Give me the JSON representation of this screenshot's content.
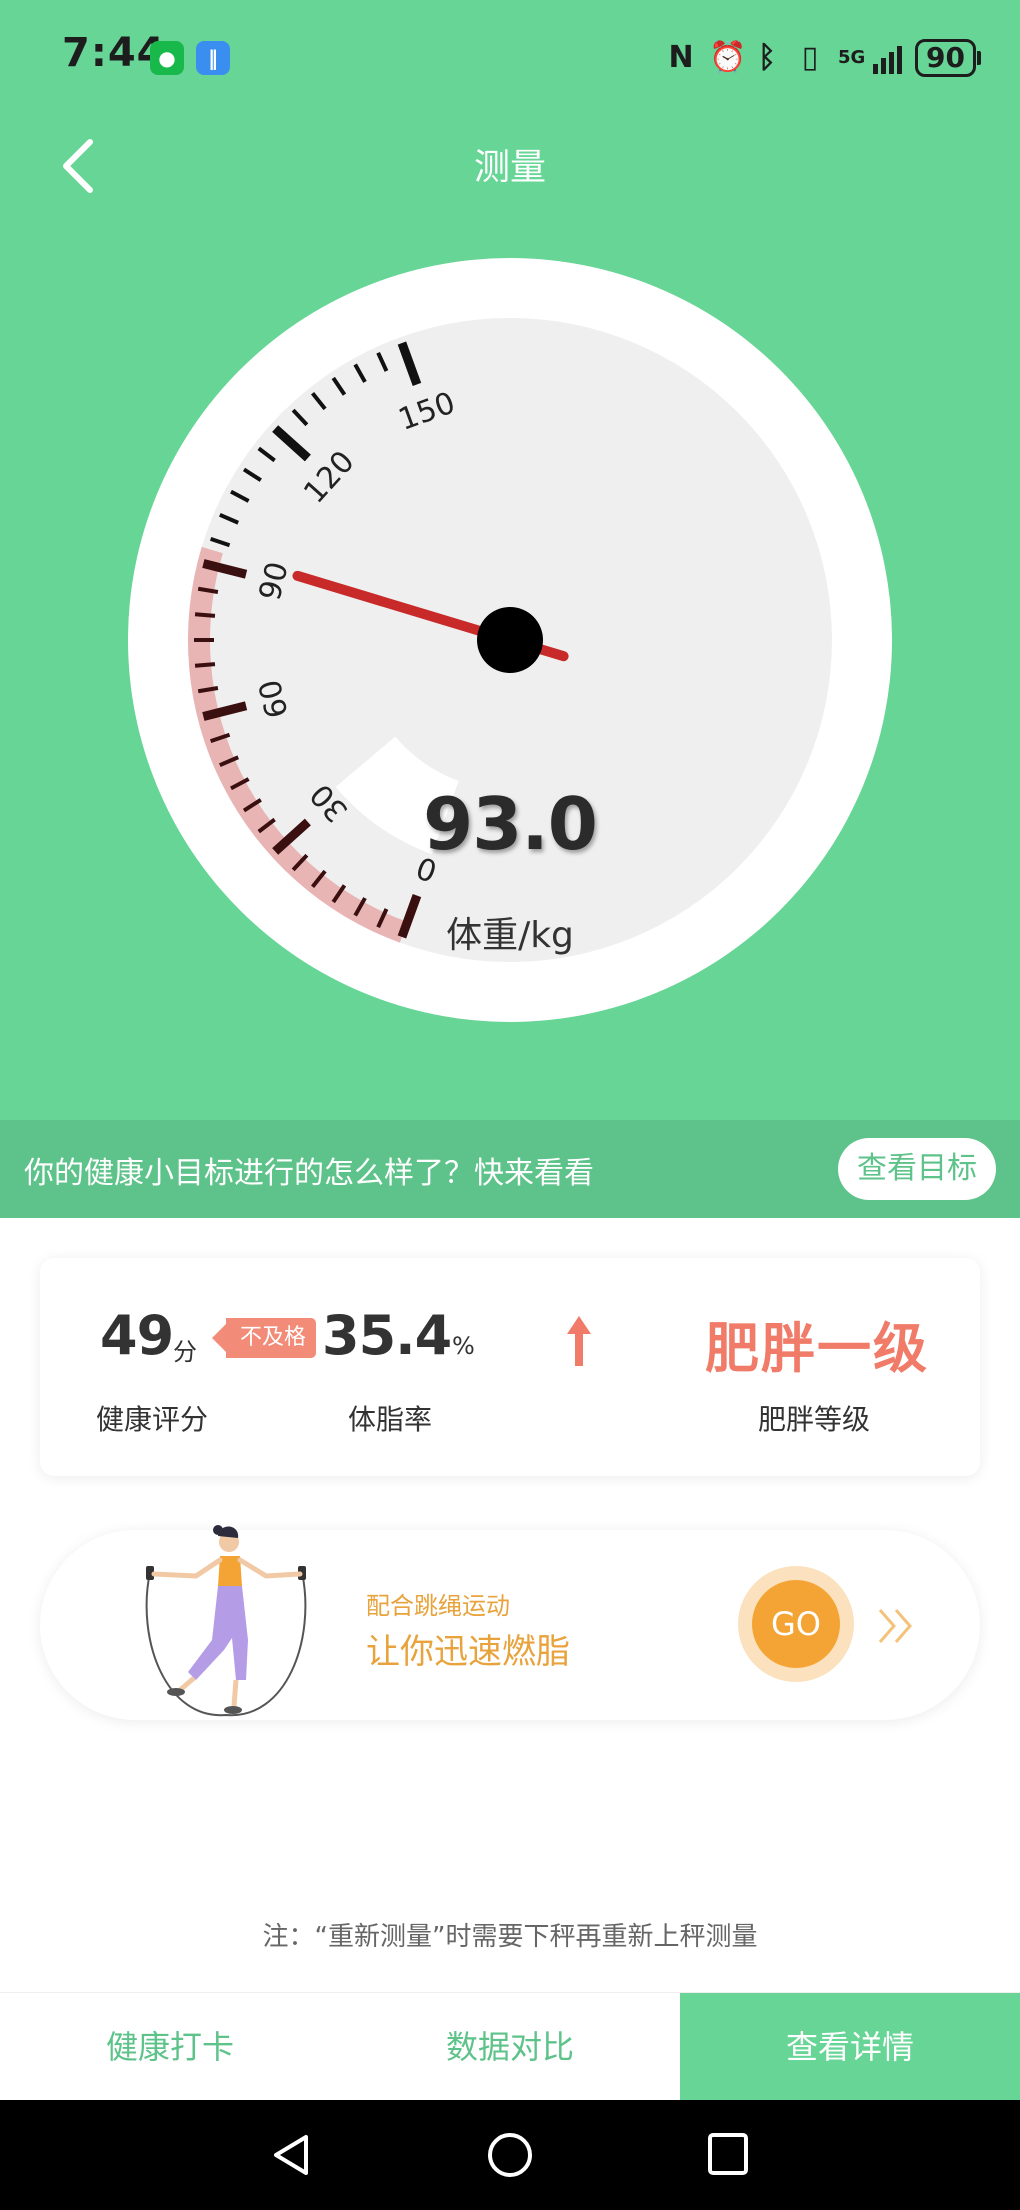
{
  "status_bar": {
    "time": "7:44",
    "battery": "90",
    "network": "5G"
  },
  "header": {
    "title": "测量"
  },
  "gauge": {
    "value": "93.0",
    "unit_label": "体重/kg",
    "reading": 93,
    "range": [
      0,
      150
    ],
    "tick_labels": [
      "0",
      "30",
      "60",
      "90",
      "120",
      "150"
    ],
    "band_range": [
      0,
      93
    ]
  },
  "goal_banner": {
    "text": "你的健康小目标进行的怎么样了？快来看看",
    "button": "查看目标"
  },
  "stats": {
    "score": {
      "value": "49",
      "unit": "分",
      "badge": "不及格",
      "label": "健康评分"
    },
    "fat": {
      "value": "35.4",
      "unit": "%",
      "label": "体脂率"
    },
    "obesity": {
      "value": "肥胖一级",
      "label": "肥胖等级"
    }
  },
  "jump_rope": {
    "subtitle": "配合跳绳运动",
    "title": "让你迅速燃脂",
    "go": "GO"
  },
  "note": "注：“重新测量”时需要下秤再重新上秤测量",
  "actions": {
    "checkin": "健康打卡",
    "compare": "数据对比",
    "details": "查看详情"
  },
  "colors": {
    "primary_green": "#66d596",
    "band_pink": "#e8b4b4",
    "needle_red": "#c82a2a",
    "accent_orange": "#f4a434",
    "warning_red": "#f07b68"
  }
}
